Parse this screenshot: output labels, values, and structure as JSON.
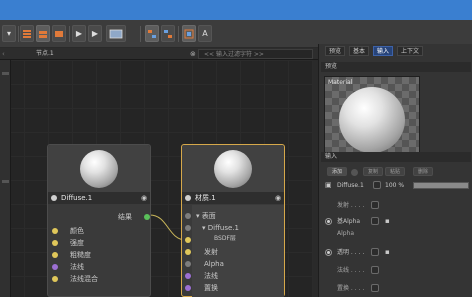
{
  "node_editor": {
    "tab_title": "节点.1",
    "search_placeholder": "<< 输入过滤字符 >>",
    "diffuse_node": {
      "title": "Diffuse.1",
      "output_label": "结果",
      "inputs": [
        "颜色",
        "强度",
        "粗糙度",
        "法线",
        "法线混合"
      ]
    },
    "material_node": {
      "title": "材质.1",
      "rows": [
        "表面",
        "Diffuse.1",
        "BSDF层",
        "发射",
        "Alpha",
        "法线",
        "置换"
      ]
    }
  },
  "attributes": {
    "tabs": [
      "预览",
      "基本",
      "输入",
      "上下文"
    ],
    "active_tab": "输入",
    "preview_section": "预览",
    "preview_label": "Material",
    "input_section": "输入",
    "buttons": [
      "添加",
      "复制",
      "粘贴",
      "删除"
    ],
    "layer": {
      "name": "Diffuse.1",
      "percent": "100 %"
    },
    "props": [
      {
        "label": "发射 . . . ."
      },
      {
        "label": "基Alpha"
      },
      {
        "label": "Alpha"
      },
      {
        "label": "透明 . . . ."
      },
      {
        "label": "法线 . . . ."
      },
      {
        "label": "置换 . . . ."
      }
    ]
  },
  "colors": {
    "accent_blue": "#3a7fd0",
    "selected_border": "#d6a84a",
    "output_port": "#5ac05a",
    "input_port": "#e0c75a",
    "surface_port": "#7d7d7d",
    "purple_port": "#9c6fd2"
  }
}
